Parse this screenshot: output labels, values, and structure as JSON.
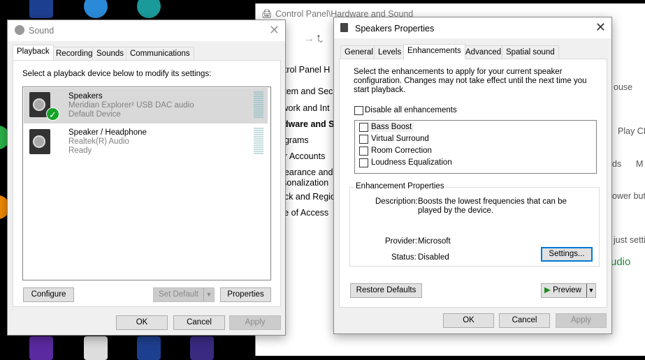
{
  "control_panel": {
    "title": "Control Panel\\Hardware and Sound",
    "breadcrumb": "ntrol Panel H",
    "nav": [
      "stem and Secu",
      "twork and Int",
      "rdware and S",
      "ograms",
      "er Accounts",
      "pearance and",
      "rsonalization",
      "ock and Regio",
      "se of Access"
    ],
    "right_links": [
      "ouse",
      "Play CD",
      "ds",
      "M",
      "ower but",
      "just setti",
      "udio"
    ]
  },
  "sound": {
    "title": "Sound",
    "tabs": [
      "Playback",
      "Recording",
      "Sounds",
      "Communications"
    ],
    "instruction": "Select a playback device below to modify its settings:",
    "devices": [
      {
        "name": "Speakers",
        "driver": "Meridian Explorer² USB DAC audio",
        "status": "Default Device",
        "default": true
      },
      {
        "name": "Speaker / Headphone",
        "driver": "Realtek(R) Audio",
        "status": "Ready",
        "default": false
      }
    ],
    "buttons": {
      "configure": "Configure",
      "set_default": "Set Default",
      "properties": "Properties",
      "ok": "OK",
      "cancel": "Cancel",
      "apply": "Apply"
    }
  },
  "props": {
    "title": "Speakers Properties",
    "tabs": [
      "General",
      "Levels",
      "Enhancements",
      "Advanced",
      "Spatial sound"
    ],
    "instruction": "Select the enhancements to apply for your current speaker configuration. Changes may not take effect until the next time you start playback.",
    "disable_all": "Disable all enhancements",
    "enhancements": [
      "Bass Boost",
      "Virtual Surround",
      "Room Correction",
      "Loudness Equalization"
    ],
    "group_label": "Enhancement Properties",
    "description_label": "Description:",
    "description": "Boosts the lowest frequencies that can be played by the device.",
    "provider_label": "Provider:",
    "provider": "Microsoft",
    "status_label": "Status:",
    "status": "Disabled",
    "buttons": {
      "settings": "Settings...",
      "restore": "Restore Defaults",
      "preview": "Preview",
      "ok": "OK",
      "cancel": "Cancel",
      "apply": "Apply"
    }
  },
  "colors": {
    "accent": "#0078d7",
    "check_green": "#16a329",
    "link": "#1a4fa0"
  }
}
